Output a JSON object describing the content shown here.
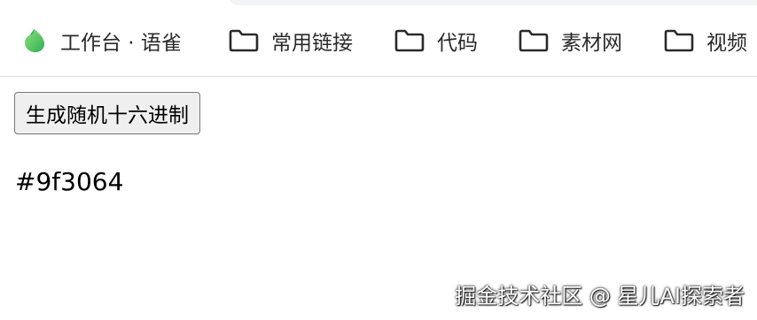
{
  "bookmarks_bar": {
    "items": [
      {
        "label": "工作台 · 语雀",
        "icon": "yuque-logo-icon"
      },
      {
        "label": "常用链接",
        "icon": "folder-icon"
      },
      {
        "label": "代码",
        "icon": "folder-icon"
      },
      {
        "label": "素材网",
        "icon": "folder-icon"
      },
      {
        "label": "视频",
        "icon": "folder-icon"
      }
    ]
  },
  "main": {
    "button_label": "生成随机十六进制",
    "hex_value": "#9f3064"
  },
  "watermark": {
    "text": "掘金技术社区 @ 星儿AI探索者"
  },
  "colors": {
    "bookmark_text": "#2a2a2a",
    "yuque_green": "#3fbc5a",
    "button_bg": "#efefef",
    "button_border": "#767676"
  }
}
